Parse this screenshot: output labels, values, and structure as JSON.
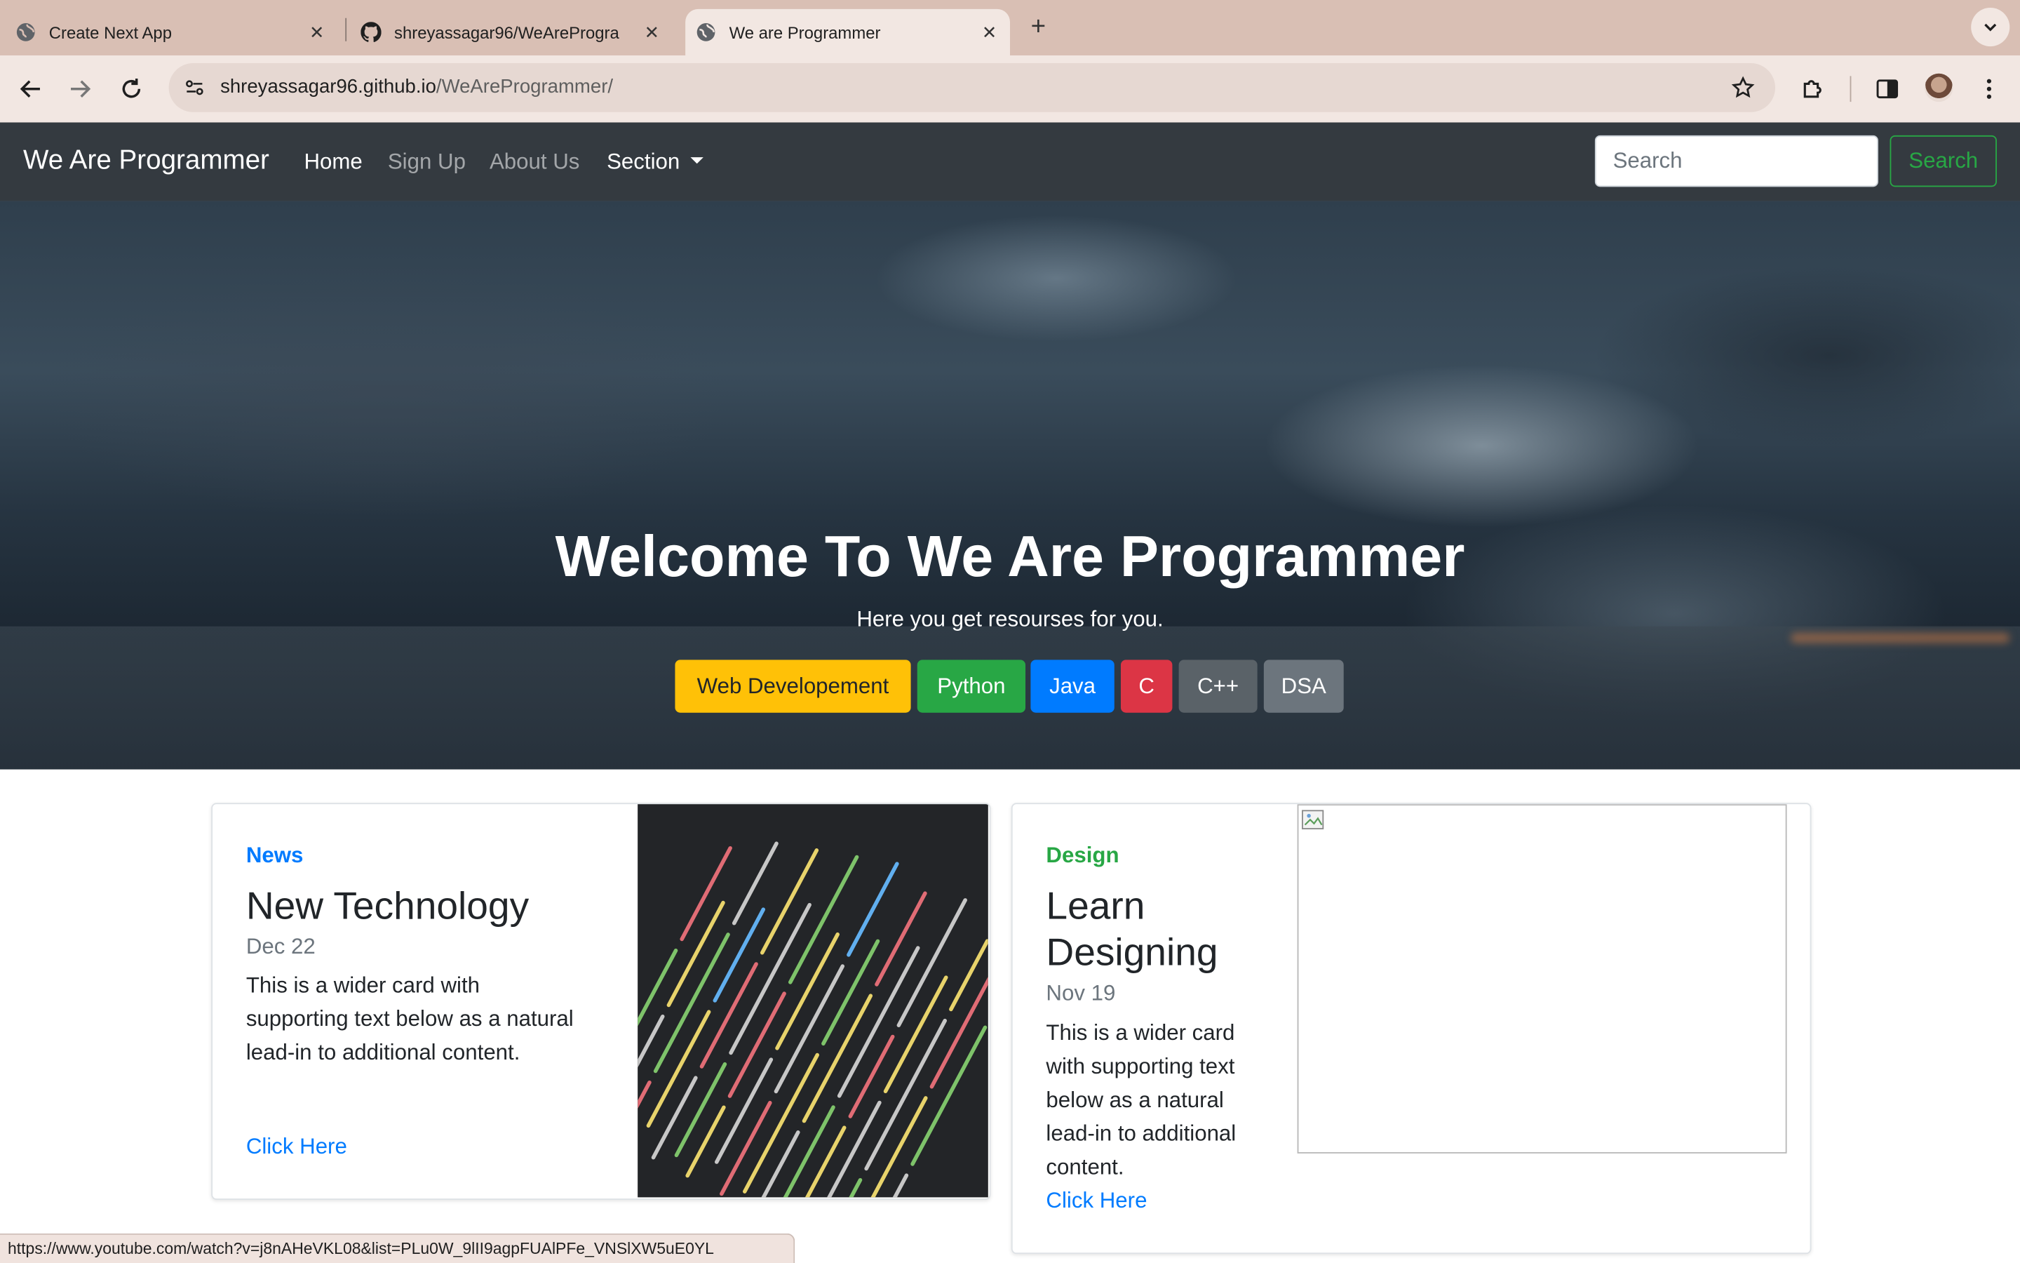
{
  "browser": {
    "tabs": [
      {
        "title": "Create Next App",
        "icon": "globe-icon",
        "active": false
      },
      {
        "title": "shreyassagar96/WeAreProgra",
        "icon": "github-icon",
        "active": false
      },
      {
        "title": "We are Programmer",
        "icon": "globe-icon",
        "active": true
      }
    ],
    "url_host": "shreyassagar96.github.io",
    "url_path": "/WeAreProgrammer/",
    "status_url": "https://www.youtube.com/watch?v=j8nAHeVKL08&list=PLu0W_9lII9agpFUAlPFe_VNSlXW5uE0YL"
  },
  "navbar": {
    "brand": "We Are Programmer",
    "links": [
      {
        "label": "Home",
        "active": true
      },
      {
        "label": "Sign Up",
        "active": false
      },
      {
        "label": "About Us",
        "active": false
      },
      {
        "label": "Section",
        "active": false,
        "dropdown": true
      }
    ],
    "search_placeholder": "Search",
    "search_button": "Search"
  },
  "hero": {
    "title": "Welcome To We Are Programmer",
    "subtitle": "Here you get resourses for you.",
    "buttons": [
      {
        "label": "Web Developement",
        "bg": "#ffc107",
        "fg": "#212529"
      },
      {
        "label": "Python",
        "bg": "#28a745",
        "fg": "#ffffff"
      },
      {
        "label": "Java",
        "bg": "#007bff",
        "fg": "#ffffff"
      },
      {
        "label": "C",
        "bg": "#dc3545",
        "fg": "#ffffff"
      },
      {
        "label": "C++",
        "bg": "#5a6268",
        "fg": "#ffffff"
      },
      {
        "label": "DSA",
        "bg": "#6c757d",
        "fg": "#ffffff"
      }
    ]
  },
  "cards": [
    {
      "category": "News",
      "category_color": "#007bff",
      "title": "New Technology",
      "date": "Dec 22",
      "text": "This is a wider card with supporting text below as a natural lead-in to additional content.",
      "link": "Click Here"
    },
    {
      "category": "Design",
      "category_color": "#28a745",
      "title": "Learn Designing",
      "date": "Nov 19",
      "text": "This is a wider card with supporting text below as a natural lead-in to additional content.",
      "link": "Click Here"
    }
  ],
  "colors": {
    "navbar_bg": "#343a40",
    "tabstrip_bg": "#d9bfb4",
    "toolbar_bg": "#f2e7e2",
    "search_green": "#28a745"
  }
}
